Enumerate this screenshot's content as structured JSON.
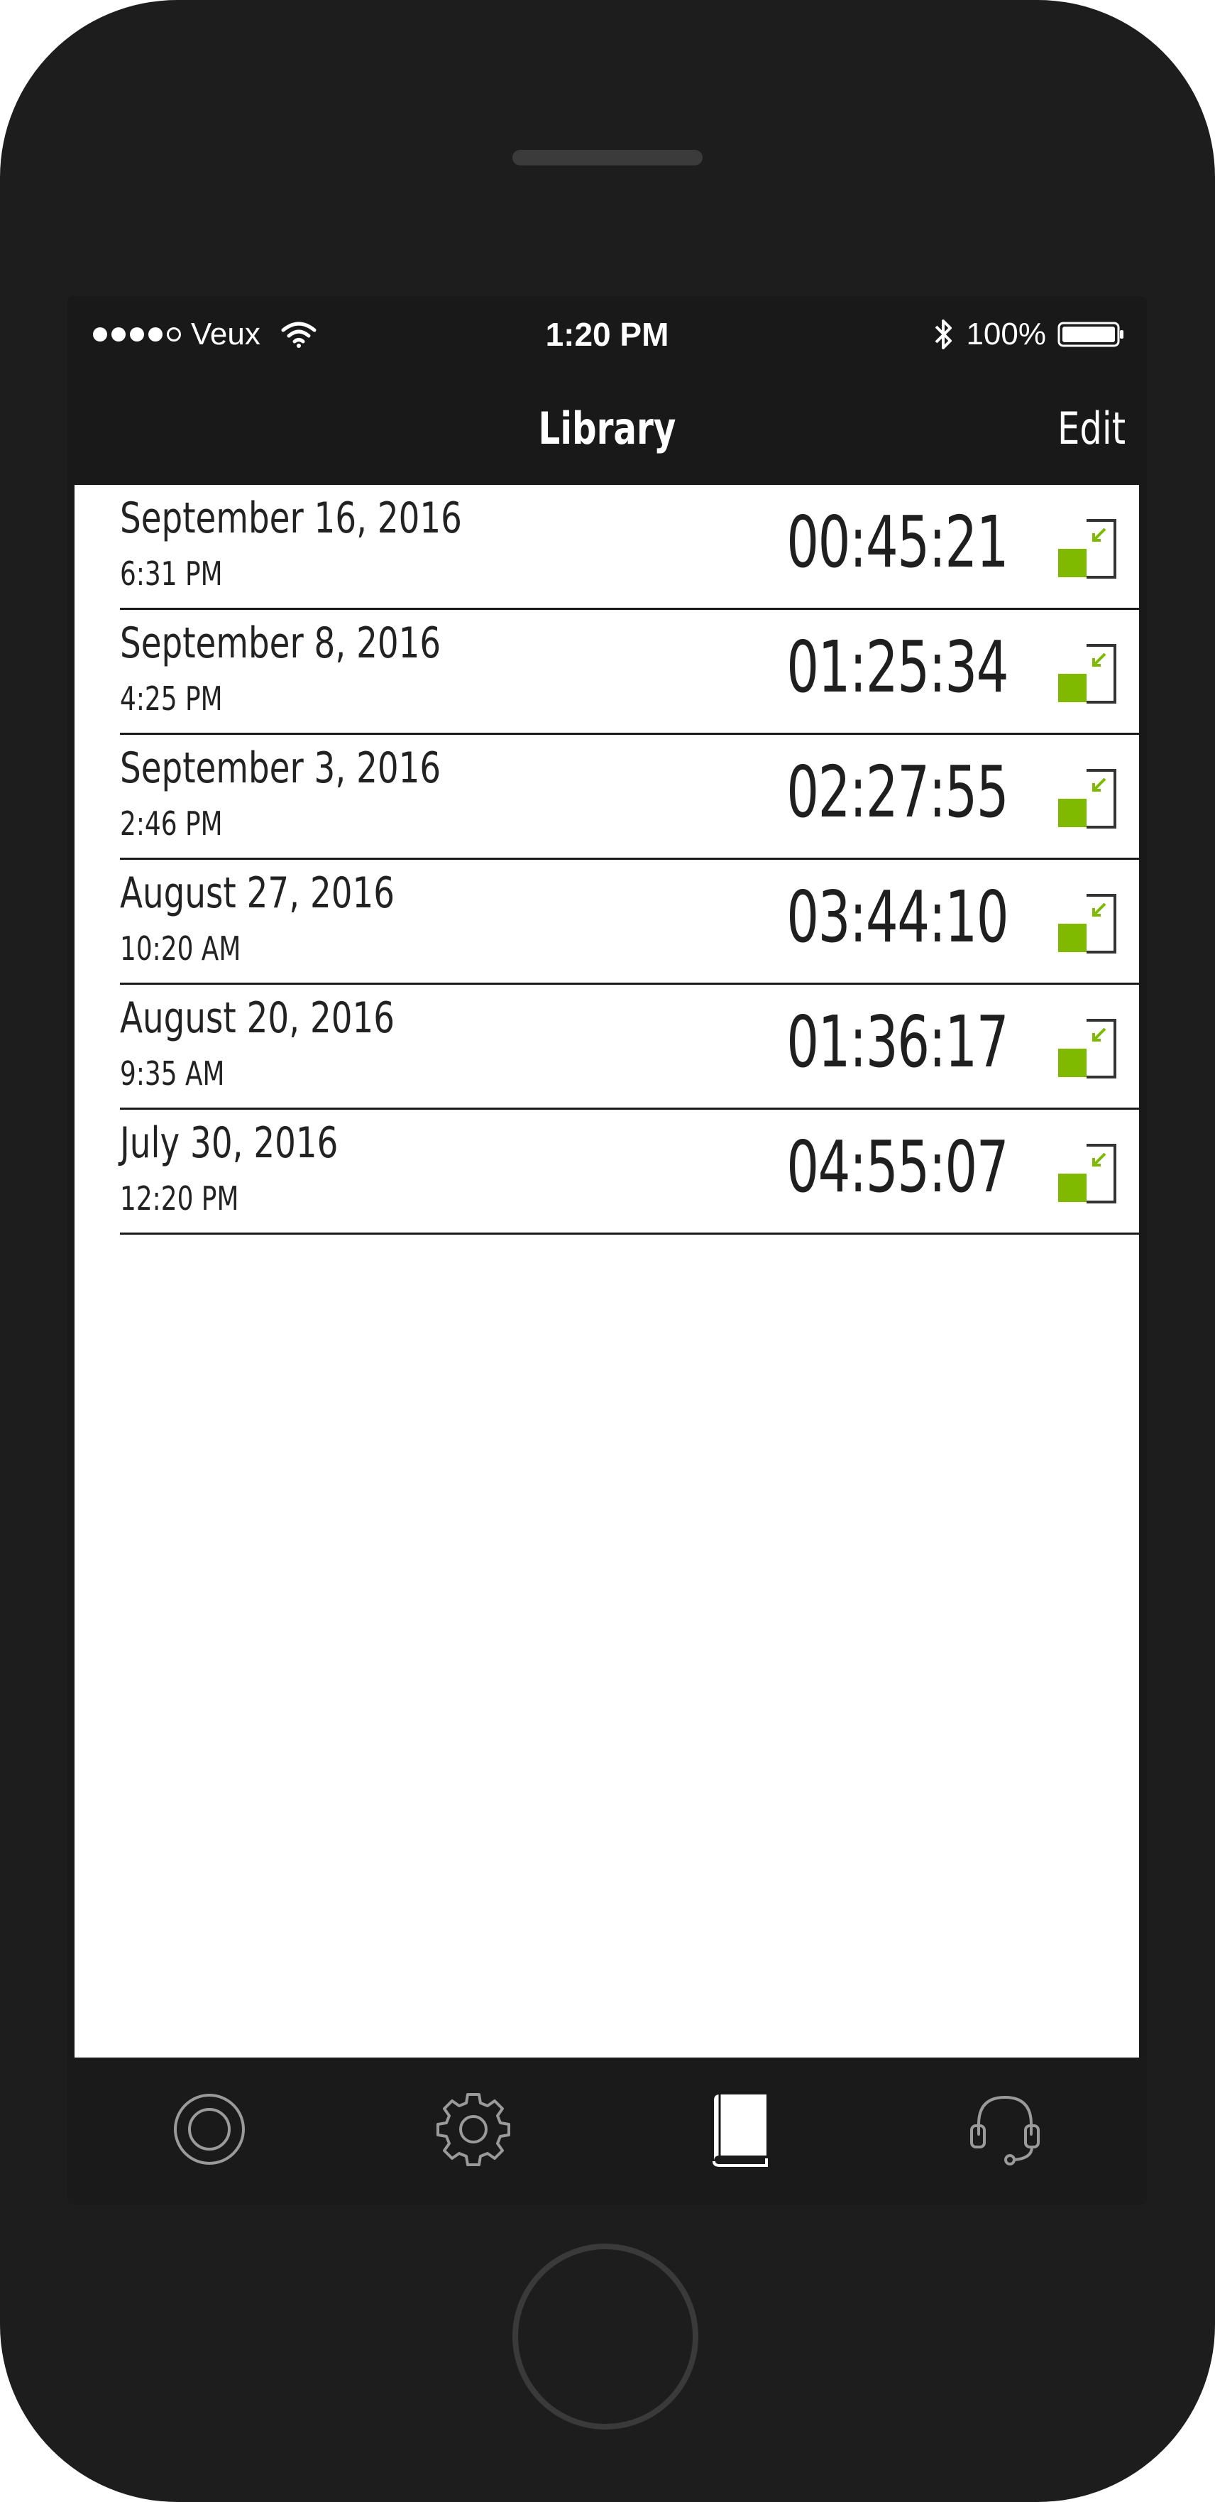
{
  "status_bar": {
    "carrier": "Veux",
    "time": "1:20 PM",
    "battery": "100%",
    "signal_icon": "signal-dots-icon",
    "wifi_icon": "wifi-icon",
    "bluetooth_icon": "bluetooth-icon",
    "battery_icon": "battery-icon"
  },
  "nav": {
    "title": "Library",
    "edit_label": "Edit"
  },
  "recordings": [
    {
      "date": "September 16, 2016",
      "time": "6:31 PM",
      "duration": "00:45:21"
    },
    {
      "date": "September 8, 2016",
      "time": "4:25 PM",
      "duration": "01:25:34"
    },
    {
      "date": "September 3, 2016",
      "time": "2:46 PM",
      "duration": "02:27:55"
    },
    {
      "date": "August 27, 2016",
      "time": "10:20 AM",
      "duration": "03:44:10"
    },
    {
      "date": "August 20, 2016",
      "time": "9:35 AM",
      "duration": "01:36:17"
    },
    {
      "date": "July 30, 2016",
      "time": "12:20 PM",
      "duration": "04:55:07"
    }
  ],
  "tabs": [
    {
      "icon": "record-icon",
      "active": false
    },
    {
      "icon": "gear-icon",
      "active": false
    },
    {
      "icon": "book-icon",
      "active": true
    },
    {
      "icon": "headset-icon",
      "active": false
    }
  ],
  "colors": {
    "accent": "#7fba00",
    "device": "#1d1d1d",
    "screen_chrome": "#191919",
    "content_bg": "#ffffff",
    "text": "#222222"
  }
}
